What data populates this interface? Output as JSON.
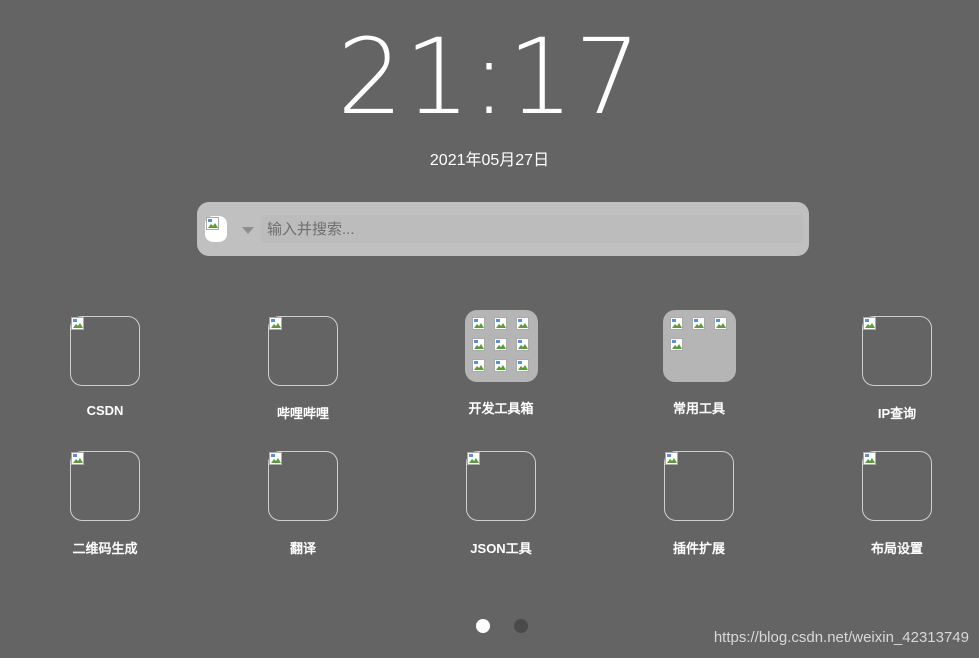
{
  "clock": {
    "time": "21:17",
    "date": "2021年05月27日"
  },
  "search": {
    "placeholder": "输入并搜索..."
  },
  "shortcuts_row1": [
    {
      "label": "CSDN",
      "type": "link"
    },
    {
      "label": "哔哩哔哩",
      "type": "link"
    },
    {
      "label": "开发工具箱",
      "type": "folder",
      "items": 9
    },
    {
      "label": "常用工具",
      "type": "folder",
      "items": 4
    },
    {
      "label": "IP查询",
      "type": "link"
    }
  ],
  "shortcuts_row2": [
    {
      "label": "二维码生成",
      "type": "link"
    },
    {
      "label": "翻译",
      "type": "link"
    },
    {
      "label": "JSON工具",
      "type": "link"
    },
    {
      "label": "插件扩展",
      "type": "link"
    },
    {
      "label": "布局设置",
      "type": "link"
    }
  ],
  "pager": {
    "pages": 2,
    "active": 1
  },
  "watermark": "https://blog.csdn.net/weixin_42313749",
  "colors": {
    "background": "#646464",
    "search_bar": "#c0c0c0",
    "folder": "#b5b5b5",
    "dot_active": "#ffffff",
    "dot_inactive": "#4a4a4a"
  }
}
